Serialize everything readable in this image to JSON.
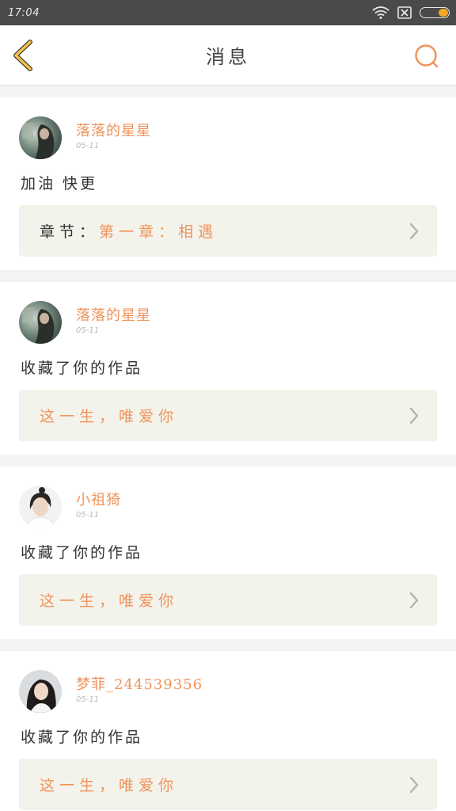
{
  "status_bar": {
    "time": "17:04",
    "icons": [
      "wifi-icon",
      "sim-off-icon",
      "battery-icon"
    ],
    "battery_color": "#f5a623"
  },
  "nav": {
    "title": "消息",
    "back_icon": "chevron-left-icon",
    "search_icon": "search-icon",
    "back_color": "#f5c242",
    "search_color": "#f0935a"
  },
  "accent_color": "#f0935a",
  "messages": [
    {
      "sender": "落落的星星",
      "date": "05-11",
      "text": "加油 快更",
      "link_prefix": "章节：",
      "link_text": "第一章：相遇",
      "avatar": "avatar-dark"
    },
    {
      "sender": "落落的星星",
      "date": "05-11",
      "text": "收藏了你的作品",
      "link_prefix": "",
      "link_text": "这一生，唯爱你",
      "avatar": "avatar-dark"
    },
    {
      "sender": "小祖猗",
      "date": "05-11",
      "text": "收藏了你的作品",
      "link_prefix": "",
      "link_text": "这一生，唯爱你",
      "avatar": "avatar-light"
    },
    {
      "sender": "梦菲_244539356",
      "date": "05-11",
      "text": "收藏了你的作品",
      "link_prefix": "",
      "link_text": "这一生，唯爱你",
      "avatar": "avatar-portrait"
    }
  ]
}
